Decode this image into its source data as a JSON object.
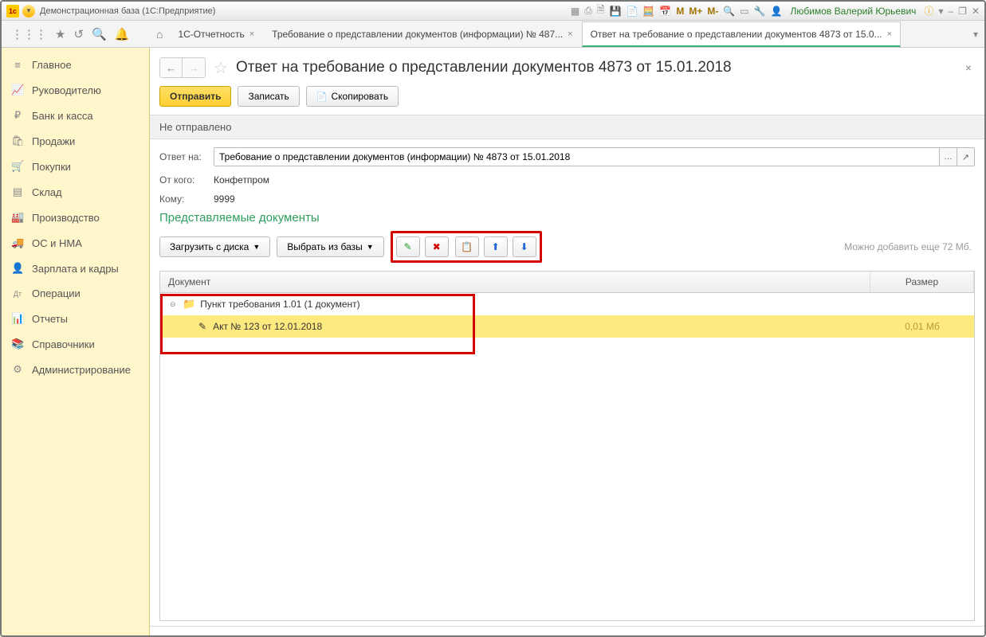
{
  "titlebar": {
    "title": "Демонстрационная база  (1С:Предприятие)",
    "user": "Любимов Валерий Юрьевич",
    "m_buttons": [
      "M",
      "M+",
      "M-"
    ]
  },
  "tabs": {
    "t1": "1С-Отчетность",
    "t2": "Требование о представлении документов (информации) № 487...",
    "t3": "Ответ на требование о представлении документов 4873 от 15.0..."
  },
  "sidebar": {
    "items": [
      {
        "icon": "≡",
        "label": "Главное"
      },
      {
        "icon": "📈",
        "label": "Руководителю"
      },
      {
        "icon": "₽",
        "label": "Банк и касса"
      },
      {
        "icon": "🛍",
        "label": "Продажи"
      },
      {
        "icon": "🛒",
        "label": "Покупки"
      },
      {
        "icon": "▤",
        "label": "Склад"
      },
      {
        "icon": "🏭",
        "label": "Производство"
      },
      {
        "icon": "🚚",
        "label": "ОС и НМА"
      },
      {
        "icon": "👤",
        "label": "Зарплата и кадры"
      },
      {
        "icon": "Дт",
        "label": "Операции"
      },
      {
        "icon": "📊",
        "label": "Отчеты"
      },
      {
        "icon": "📚",
        "label": "Справочники"
      },
      {
        "icon": "⚙",
        "label": "Администрирование"
      }
    ]
  },
  "doc": {
    "title": "Ответ на требование о представлении документов 4873 от 15.01.2018",
    "send": "Отправить",
    "save": "Записать",
    "copy": "Скопировать",
    "status": "Не отправлено",
    "answer_label": "Ответ на:",
    "answer_value": "Требование о представлении документов (информации) № 4873 от 15.01.2018",
    "from_label": "От кого:",
    "from_value": "Конфетпром",
    "to_label": "Кому:",
    "to_value": "9999",
    "section": "Представляемые документы",
    "load": "Загрузить с диска",
    "choose": "Выбрать из базы",
    "hint": "Можно добавить еще 72 Мб.",
    "th_doc": "Документ",
    "th_size": "Размер",
    "group": "Пункт требования 1.01 (1 документ)",
    "child": "Акт № 123 от 12.01.2018",
    "child_size": "0,01 Мб"
  }
}
